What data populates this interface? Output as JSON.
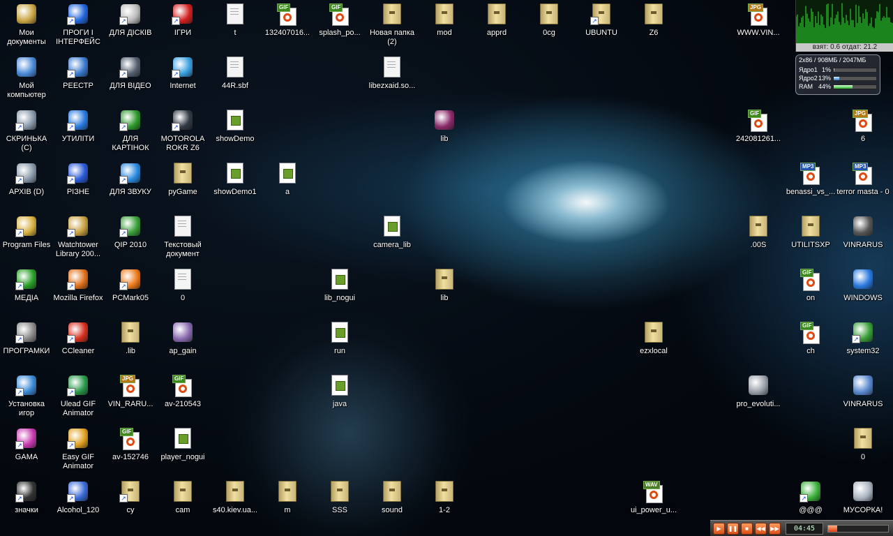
{
  "desktop": {
    "icons": [
      {
        "label": "Мои документы",
        "glyph": "folder-docs-icon",
        "kind": "generic",
        "color": "#c9a544"
      },
      {
        "label": "ПРОГИ І ІНТЕРФЕЙС",
        "glyph": "blue-flame-icon",
        "kind": "generic",
        "color": "#2266dd",
        "shortcut": true
      },
      {
        "label": "ДЛЯ ДІСКІВ",
        "glyph": "cd-drive-icon",
        "kind": "generic",
        "color": "#bbbbbb",
        "shortcut": true
      },
      {
        "label": "ІГРИ",
        "glyph": "red-devil-icon",
        "kind": "generic",
        "color": "#d42020",
        "shortcut": true
      },
      {
        "label": "t",
        "glyph": "text-file-icon",
        "kind": "docwhite"
      },
      {
        "label": "132407016...",
        "glyph": "gif-file-icon",
        "kind": "badge",
        "tag": "GIF"
      },
      {
        "label": "splash_po...",
        "glyph": "gif-file-icon",
        "kind": "badge",
        "tag": "GIF"
      },
      {
        "label": "Новая папка (2)",
        "glyph": "folder-icon",
        "kind": "folder"
      },
      {
        "label": "mod",
        "glyph": "folder-icon",
        "kind": "folder"
      },
      {
        "label": "apprd",
        "glyph": "folder-icon",
        "kind": "folder"
      },
      {
        "label": "0cg",
        "glyph": "folder-icon",
        "kind": "folder"
      },
      {
        "label": "UBUNTU",
        "glyph": "folder-icon",
        "kind": "folder",
        "shortcut": true
      },
      {
        "label": "Z6",
        "glyph": "folder-icon",
        "kind": "folder"
      },
      {
        "label": "WWW.VIN...",
        "glyph": "jpg-file-icon",
        "kind": "badge",
        "tag": "JPG"
      },
      {
        "label": "Мой компьютер",
        "glyph": "my-computer-icon",
        "kind": "generic",
        "color": "#4a8ad8"
      },
      {
        "label": "РЕЕСТР",
        "glyph": "registry-icon",
        "kind": "generic",
        "color": "#3a7ad0",
        "shortcut": true
      },
      {
        "label": "ДЛЯ ВІДЕО",
        "glyph": "camcorder-icon",
        "kind": "generic",
        "color": "#556070",
        "shortcut": true
      },
      {
        "label": "Internet",
        "glyph": "internet-icon",
        "kind": "generic",
        "color": "#3aa0e0",
        "shortcut": true
      },
      {
        "label": "44R.sbf",
        "glyph": "sbf-file-icon",
        "kind": "docwhite"
      },
      {
        "label": "libezxaid.so...",
        "glyph": "so-file-icon",
        "kind": "docwhite"
      },
      {
        "label": "СКРИНЬКА (C)",
        "glyph": "drive-c-icon",
        "kind": "generic",
        "color": "#8899aa",
        "shortcut": true
      },
      {
        "label": "УТИЛІТИ",
        "glyph": "refresh-arrows-icon",
        "kind": "generic",
        "color": "#2a7ae0",
        "shortcut": true
      },
      {
        "label": "ДЛЯ КАРТІНОК",
        "glyph": "tree-icon",
        "kind": "generic",
        "color": "#2e9a2e",
        "shortcut": true
      },
      {
        "label": "MOTOROLA ROKR Z6",
        "glyph": "phone-icon",
        "kind": "generic",
        "color": "#333a44",
        "shortcut": true
      },
      {
        "label": "showDemo",
        "glyph": "note-file-icon",
        "kind": "note"
      },
      {
        "label": "lib",
        "glyph": "winrar-archive-icon",
        "kind": "generic",
        "color": "#8a2a6a"
      },
      {
        "label": "242081261...",
        "glyph": "gif-file-icon",
        "kind": "badge",
        "tag": "GIF"
      },
      {
        "label": "6",
        "glyph": "jpg-file-icon",
        "kind": "badge",
        "tag": "JPG"
      },
      {
        "label": "АРХІВ (D)",
        "glyph": "drive-d-icon",
        "kind": "generic",
        "color": "#8899aa",
        "shortcut": true
      },
      {
        "label": "РІЗНЕ",
        "glyph": "help-icon",
        "kind": "generic",
        "color": "#2a5ad8",
        "shortcut": true
      },
      {
        "label": "ДЛЯ ЗВУКУ",
        "glyph": "globe-music-icon",
        "kind": "generic",
        "color": "#2a8ae0",
        "shortcut": true
      },
      {
        "label": "pyGame",
        "glyph": "folder-icon",
        "kind": "folder"
      },
      {
        "label": "showDemo1",
        "glyph": "note-file-icon",
        "kind": "note"
      },
      {
        "label": "a",
        "glyph": "note-file-icon",
        "kind": "note"
      },
      {
        "label": "benassi_vs_...",
        "glyph": "mp3-file-icon",
        "kind": "badge",
        "tag": "MP3"
      },
      {
        "label": "terror masta - 0",
        "glyph": "mp3-file-icon",
        "kind": "badge",
        "tag": "MP3"
      },
      {
        "label": "Program Files",
        "glyph": "folder-program-icon",
        "kind": "generic",
        "color": "#d8b040",
        "shortcut": true
      },
      {
        "label": "Watchtower Library 200...",
        "glyph": "watchtower-icon",
        "kind": "generic",
        "color": "#c8a040",
        "shortcut": true
      },
      {
        "label": "QIP 2010",
        "glyph": "qip-icon",
        "kind": "generic",
        "color": "#3aa03a",
        "shortcut": true
      },
      {
        "label": "Текстовый документ",
        "glyph": "text-file-icon",
        "kind": "docwhite"
      },
      {
        "label": "camera_lib",
        "glyph": "note-file-icon",
        "kind": "note"
      },
      {
        "label": ".00S",
        "glyph": "folder-icon",
        "kind": "folder"
      },
      {
        "label": "UTILITSXP",
        "glyph": "folder-icon",
        "kind": "folder"
      },
      {
        "label": "VINRARUS",
        "glyph": "chip-icon",
        "kind": "generic",
        "color": "#555555"
      },
      {
        "label": "МЕДІА",
        "glyph": "green-arrow-icon",
        "kind": "generic",
        "color": "#2aa02a",
        "shortcut": true
      },
      {
        "label": "Mozilla Firefox",
        "glyph": "firefox-icon",
        "kind": "generic",
        "color": "#e0701a",
        "shortcut": true
      },
      {
        "label": "PCMark05",
        "glyph": "pcmark-icon",
        "kind": "generic",
        "color": "#ee7a1a",
        "shortcut": true
      },
      {
        "label": "0",
        "glyph": "text-file-icon",
        "kind": "docwhite"
      },
      {
        "label": "lib_nogui",
        "glyph": "note-file-icon",
        "kind": "note"
      },
      {
        "label": "lib",
        "glyph": "folder-icon",
        "kind": "folder"
      },
      {
        "label": "on",
        "glyph": "gif-file-icon",
        "kind": "badge",
        "tag": "GIF"
      },
      {
        "label": "WINDOWS",
        "glyph": "windows-flag-icon",
        "kind": "generic",
        "color": "#2a7ae0"
      },
      {
        "label": "ПРОГРАМКИ",
        "glyph": "gears-icon",
        "kind": "generic",
        "color": "#8a8a8a",
        "shortcut": true
      },
      {
        "label": "CCleaner",
        "glyph": "ccleaner-icon",
        "kind": "generic",
        "color": "#d83020",
        "shortcut": true
      },
      {
        "label": ".lib",
        "glyph": "folder-icon",
        "kind": "folder"
      },
      {
        "label": "ap_gain",
        "glyph": "cd-audio-icon",
        "kind": "generic",
        "color": "#8a6ab0"
      },
      {
        "label": "run",
        "glyph": "note-file-icon",
        "kind": "note"
      },
      {
        "label": "ezxlocal",
        "glyph": "folder-icon",
        "kind": "folder"
      },
      {
        "label": "ch",
        "glyph": "gif-file-icon",
        "kind": "badge",
        "tag": "GIF"
      },
      {
        "label": "system32",
        "glyph": "windows-xp-icon",
        "kind": "generic",
        "color": "#3aa03a",
        "shortcut": true
      },
      {
        "label": "Установка игор",
        "glyph": "install-icon",
        "kind": "generic",
        "color": "#3a8ad8",
        "shortcut": true
      },
      {
        "label": "Ulead GIF Animator",
        "glyph": "ulead-gif-icon",
        "kind": "generic",
        "color": "#2a9a4a",
        "shortcut": true
      },
      {
        "label": "VIN_RARU...",
        "glyph": "jpg-file-icon",
        "kind": "badge",
        "tag": "JPG"
      },
      {
        "label": "av-210543",
        "glyph": "gif-file-icon",
        "kind": "badge",
        "tag": "GIF"
      },
      {
        "label": "java",
        "glyph": "note-file-icon",
        "kind": "note"
      },
      {
        "label": "pro_evoluti...",
        "glyph": "gamepad-icon",
        "kind": "generic",
        "color": "#9aa0aa"
      },
      {
        "label": "VINRARUS",
        "glyph": "window-app-icon",
        "kind": "generic",
        "color": "#5a8ad0"
      },
      {
        "label": "GAMA",
        "glyph": "gama-icon",
        "kind": "generic",
        "color": "#c83ab0",
        "shortcut": true
      },
      {
        "label": "Easy GIF Animator",
        "glyph": "easy-gif-icon",
        "kind": "generic",
        "color": "#e0a020",
        "shortcut": true
      },
      {
        "label": "av-152746",
        "glyph": "gif-file-icon",
        "kind": "badge",
        "tag": "GIF"
      },
      {
        "label": "player_nogui",
        "glyph": "note-file-icon",
        "kind": "note"
      },
      {
        "label": "0",
        "glyph": "folder-icon",
        "kind": "folder"
      },
      {
        "label": "значки",
        "glyph": "shortcut-icon",
        "kind": "generic",
        "color": "#333333",
        "shortcut": true
      },
      {
        "label": "Alcohol_120",
        "glyph": "alcohol-icon",
        "kind": "generic",
        "color": "#3a6ad8",
        "shortcut": true
      },
      {
        "label": "cy",
        "glyph": "folder-icon",
        "kind": "folder",
        "shortcut": true
      },
      {
        "label": "cam",
        "glyph": "folder-icon",
        "kind": "folder"
      },
      {
        "label": "s40.kiev.ua...",
        "glyph": "folder-icon",
        "kind": "folder"
      },
      {
        "label": "m",
        "glyph": "folder-icon",
        "kind": "folder"
      },
      {
        "label": "SSS",
        "glyph": "folder-icon",
        "kind": "folder"
      },
      {
        "label": "sound",
        "glyph": "folder-icon",
        "kind": "folder"
      },
      {
        "label": "1-2",
        "glyph": "folder-icon",
        "kind": "folder"
      },
      {
        "label": "ui_power_u...",
        "glyph": "wav-file-icon",
        "kind": "badge",
        "tag": "WAV"
      },
      {
        "label": "@@@",
        "glyph": "green-plus-icon",
        "kind": "generic",
        "color": "#3ab03a",
        "shortcut": true
      },
      {
        "label": "МУСОРКА!",
        "glyph": "recycle-bin-icon",
        "kind": "generic",
        "color": "#aab4c0"
      }
    ]
  },
  "sysmon": {
    "graph_caption": "взят: 0.6 отдат: 21.2",
    "header": "2x86 / 908МБ / 2047МБ",
    "rows": [
      {
        "name": "Ядро1",
        "percent": "1%",
        "value": 0.01
      },
      {
        "name": "Ядро2",
        "percent": "13%",
        "value": 0.13
      },
      {
        "name": "RAM",
        "percent": "44%",
        "value": 0.44
      }
    ]
  },
  "player": {
    "time": "04:45",
    "buttons": [
      "play",
      "pause",
      "stop",
      "prev",
      "next"
    ],
    "progress": 0.15
  }
}
